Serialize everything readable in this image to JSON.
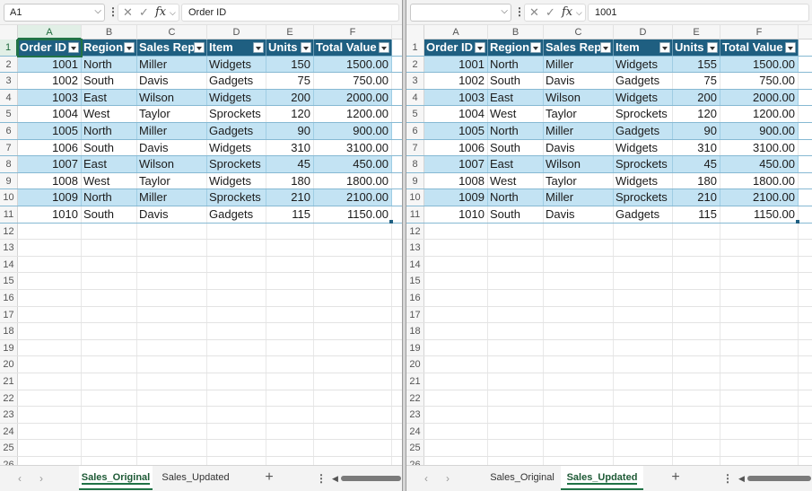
{
  "left_pane": {
    "name_box": "A1",
    "formula": "Order ID",
    "columns": [
      "A",
      "B",
      "C",
      "D",
      "E",
      "F"
    ],
    "active_sheet": "Sales_Original",
    "table": {
      "headers": [
        "Order ID",
        "Region",
        "Sales Rep",
        "Item",
        "Units",
        "Total Value"
      ],
      "rows": [
        [
          "1001",
          "North",
          "Miller",
          "Widgets",
          "150",
          "1500.00"
        ],
        [
          "1002",
          "South",
          "Davis",
          "Gadgets",
          "75",
          "750.00"
        ],
        [
          "1003",
          "East",
          "Wilson",
          "Widgets",
          "200",
          "2000.00"
        ],
        [
          "1004",
          "West",
          "Taylor",
          "Sprockets",
          "120",
          "1200.00"
        ],
        [
          "1005",
          "North",
          "Miller",
          "Gadgets",
          "90",
          "900.00"
        ],
        [
          "1006",
          "South",
          "Davis",
          "Widgets",
          "310",
          "3100.00"
        ],
        [
          "1007",
          "East",
          "Wilson",
          "Sprockets",
          "45",
          "450.00"
        ],
        [
          "1008",
          "West",
          "Taylor",
          "Widgets",
          "180",
          "1800.00"
        ],
        [
          "1009",
          "North",
          "Miller",
          "Sprockets",
          "210",
          "2100.00"
        ],
        [
          "1010",
          "South",
          "Davis",
          "Gadgets",
          "115",
          "1150.00"
        ]
      ]
    }
  },
  "right_pane": {
    "name_box": "",
    "formula": "1001",
    "columns": [
      "A",
      "B",
      "C",
      "D",
      "E",
      "F"
    ],
    "active_sheet": "Sales_Updated",
    "table": {
      "headers": [
        "Order ID",
        "Region",
        "Sales Rep",
        "Item",
        "Units",
        "Total Value"
      ],
      "rows": [
        [
          "1001",
          "North",
          "Miller",
          "Widgets",
          "155",
          "1500.00"
        ],
        [
          "1002",
          "South",
          "Davis",
          "Gadgets",
          "75",
          "750.00"
        ],
        [
          "1003",
          "East",
          "Wilson",
          "Widgets",
          "200",
          "2000.00"
        ],
        [
          "1004",
          "West",
          "Taylor",
          "Sprockets",
          "120",
          "1200.00"
        ],
        [
          "1005",
          "North",
          "Miller",
          "Gadgets",
          "90",
          "900.00"
        ],
        [
          "1006",
          "South",
          "Davis",
          "Widgets",
          "310",
          "3100.00"
        ],
        [
          "1007",
          "East",
          "Wilson",
          "Sprockets",
          "45",
          "450.00"
        ],
        [
          "1008",
          "West",
          "Taylor",
          "Widgets",
          "180",
          "1800.00"
        ],
        [
          "1009",
          "North",
          "Miller",
          "Sprockets",
          "210",
          "2100.00"
        ],
        [
          "1010",
          "South",
          "Davis",
          "Gadgets",
          "115",
          "1150.00"
        ]
      ]
    }
  },
  "row_numbers": [
    "1",
    "2",
    "3",
    "4",
    "5",
    "6",
    "7",
    "8",
    "9",
    "10",
    "11",
    "12",
    "13",
    "14",
    "15",
    "16",
    "17",
    "18",
    "19",
    "20",
    "21",
    "22",
    "23",
    "24",
    "25",
    "26"
  ],
  "sheet_tabs": [
    "Sales_Original",
    "Sales_Updated"
  ],
  "icons": {
    "cancel": "✕",
    "enter": "✓",
    "fx": "fx",
    "dropdown": "⌵",
    "vdots": "⋮",
    "add_sheet": "+",
    "prev": "‹",
    "next": "›",
    "scroll_left": "◀"
  },
  "colors": {
    "table_header": "#1f5f81",
    "band": "#c3e3f3",
    "accent_green": "#217346"
  }
}
